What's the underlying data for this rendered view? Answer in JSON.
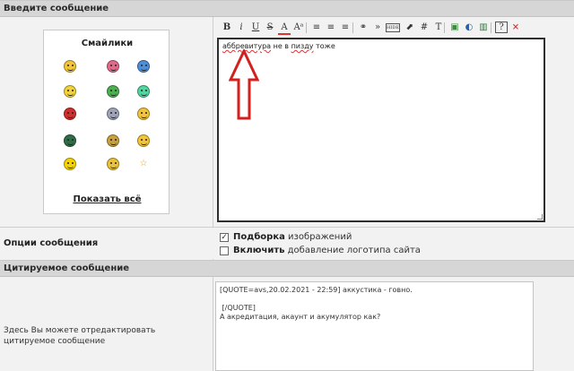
{
  "header_message": "Введите сообщение",
  "smilies": {
    "title": "Смайлики",
    "show_all": "Показать всё",
    "items": [
      {
        "icon": "cool-smiley-icon",
        "color": "#f2c43a"
      },
      {
        "icon": "angry-smiley-icon",
        "color": "#e06a8a"
      },
      {
        "icon": "pirate-smiley-icon",
        "color": "#4f8fd8"
      },
      {
        "icon": "thinking-smiley-icon",
        "color": "#f2d23a"
      },
      {
        "icon": "gun-smiley-icon",
        "color": "#4caf50"
      },
      {
        "icon": "green-smiley-icon",
        "color": "#4fd6a1"
      },
      {
        "icon": "devil-smiley-icon",
        "color": "#d12e2e"
      },
      {
        "icon": "sad-smiley-icon",
        "color": "#9ea3b5"
      },
      {
        "icon": "wink-smiley-icon",
        "color": "#f2c43a"
      },
      {
        "icon": "dark-smiley-icon",
        "color": "#2f6d47"
      },
      {
        "icon": "book-smiley-icon",
        "color": "#c8a040"
      },
      {
        "icon": "cheer-smiley-icon",
        "color": "#f2c43a"
      },
      {
        "icon": "bunny-smiley-icon",
        "color": "#f4d400"
      },
      {
        "icon": "laugh-smiley-icon",
        "color": "#e8c23a"
      },
      {
        "icon": "star-icon",
        "color": "#e0a030"
      }
    ]
  },
  "toolbar": {
    "buttons": [
      "B",
      "i",
      "U",
      "S",
      "A",
      "Aᵃ",
      "≡",
      "≡",
      "≡",
      "⚭",
      "»",
      "HIDE",
      "⬈",
      "#",
      "T",
      "▣",
      "◐",
      "▥",
      "?",
      "×"
    ]
  },
  "editor": {
    "word1": "аббревитура",
    "word2": " не в ",
    "word3": "пизду",
    "word4": " тоже"
  },
  "options": {
    "label": "Опции сообщения",
    "opt1_bold": "Подборка",
    "opt1_rest": " изображений",
    "opt1_checked": true,
    "opt2_bold": "Включить",
    "opt2_rest": " добавление логотипа сайта",
    "opt2_checked": false
  },
  "quote_header": "Цитируемое сообщение",
  "quote": {
    "label": "Здесь Вы можете отредактировать цитируемое сообщение",
    "text": "[QUOTE=avs,20.02.2021 - 22:59] аккустика - говно.\n\n [/QUOTE]\nА акредитация, акаунт и акумулятор как?"
  },
  "colors": {
    "arrow": "#d41f1f",
    "header_bg": "#d6d6d6"
  }
}
